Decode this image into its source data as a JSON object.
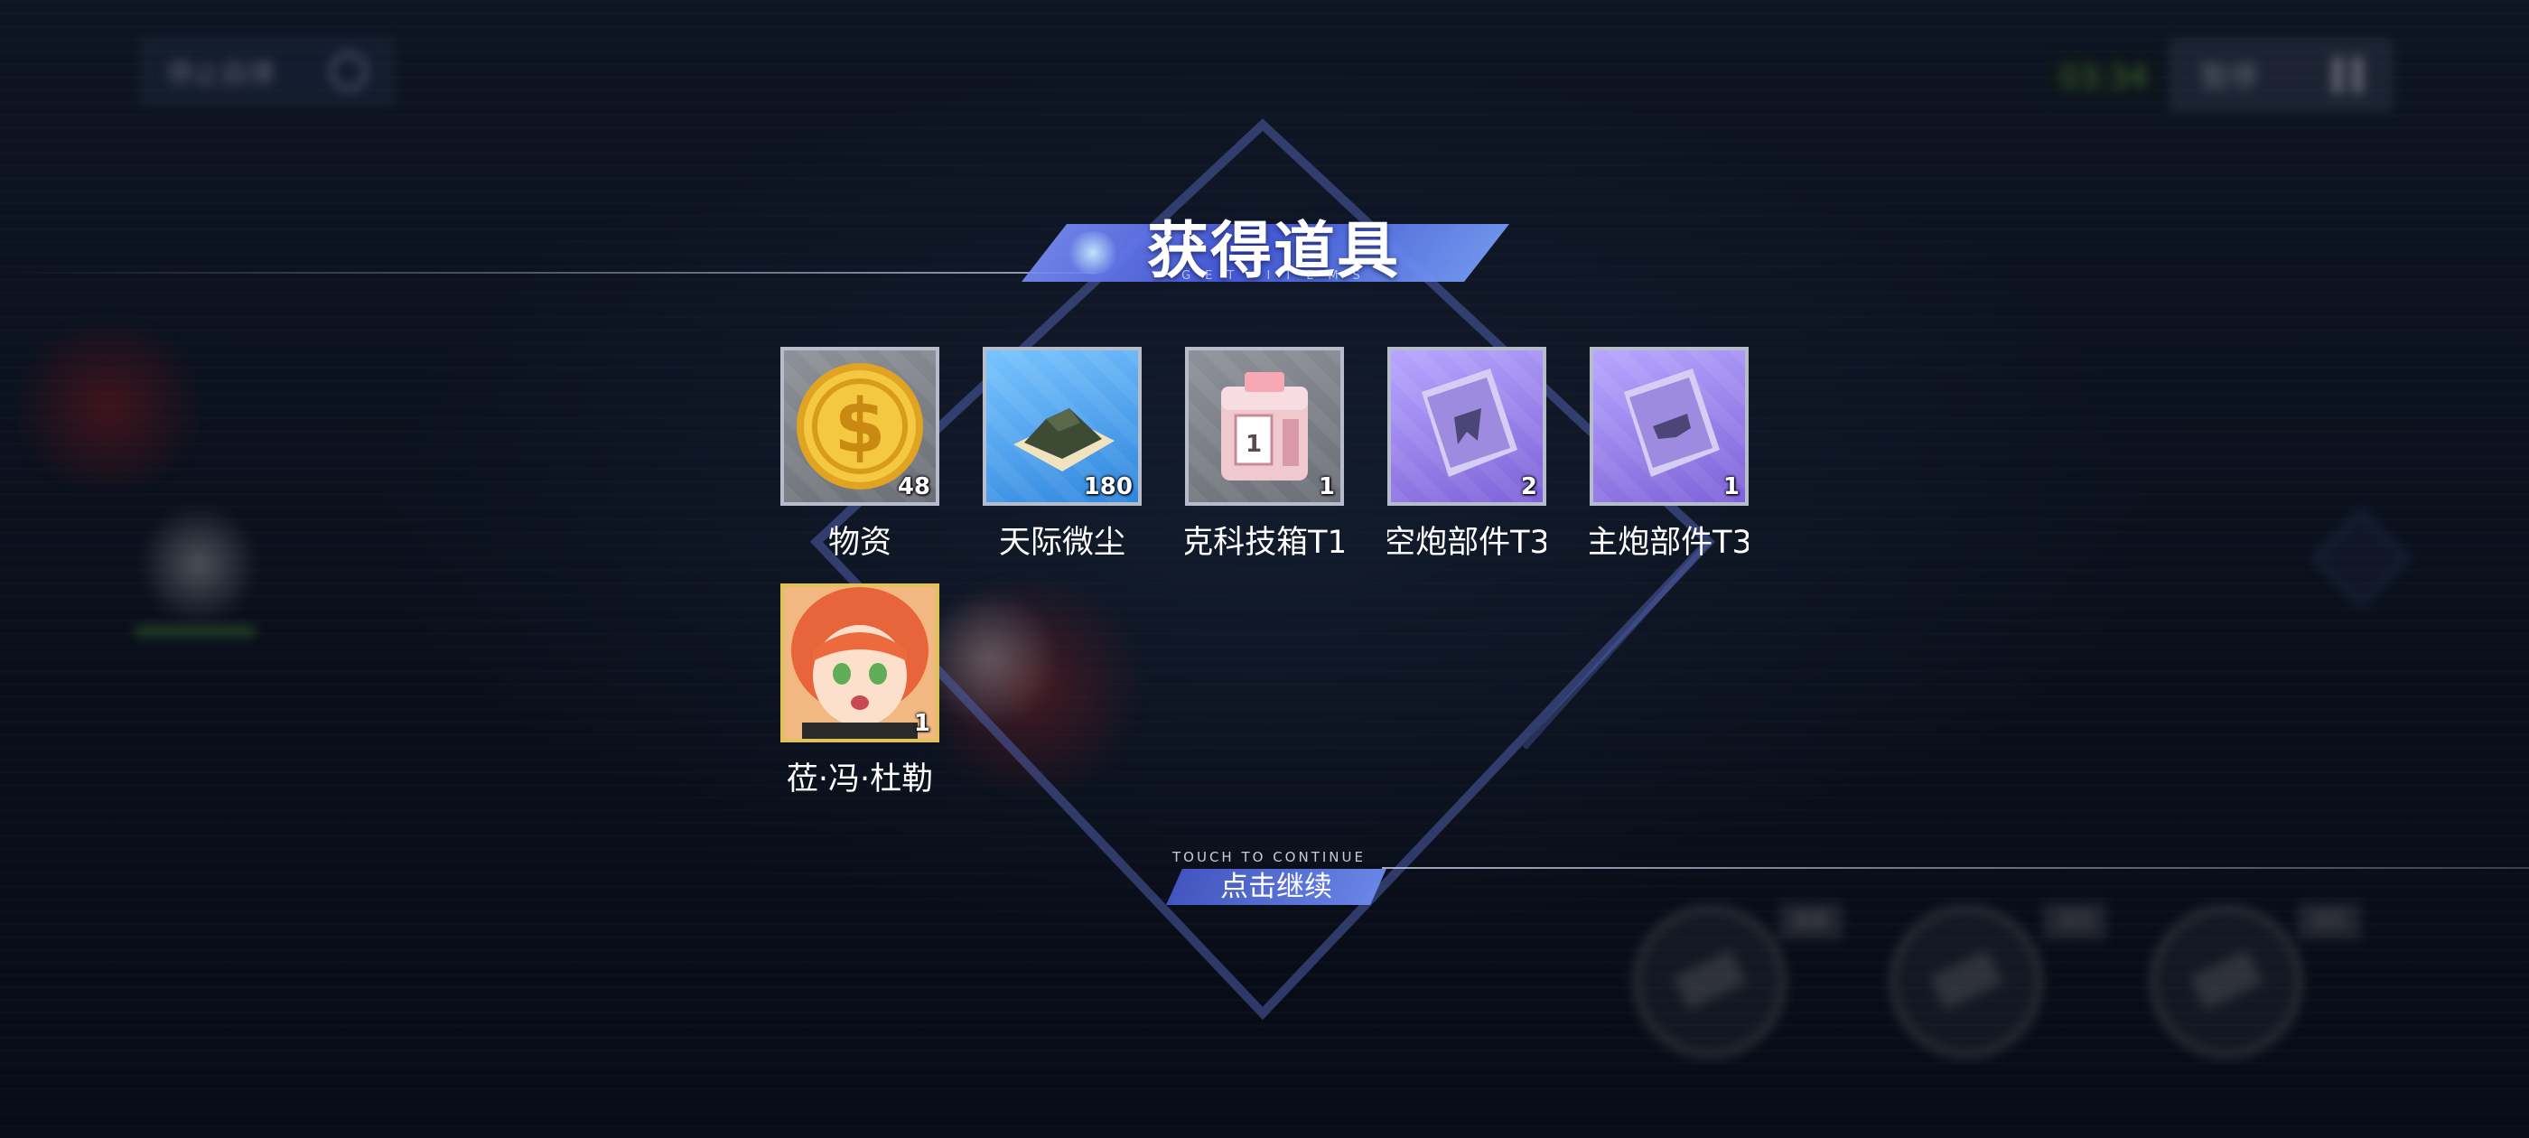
{
  "hud": {
    "auto_battle_label": "停止自律",
    "timer": "03:34",
    "pause_label": "暂停"
  },
  "skills": {
    "counts": [
      "8/8",
      "3/3",
      "0/1"
    ]
  },
  "reward_panel": {
    "title": "获得道具",
    "subtitle": "GET ITEMS",
    "continue_hint": "TOUCH TO CONTINUE",
    "continue_label": "点击继续"
  },
  "items": [
    {
      "name": "物资",
      "count": "48",
      "icon": "coin-icon",
      "rarity": "gray"
    },
    {
      "name": "天际微尘",
      "count": "180",
      "icon": "dust-pile-icon",
      "rarity": "blue"
    },
    {
      "name": "克科技箱T1",
      "count": "1",
      "icon": "tech-box-icon",
      "rarity": "gray"
    },
    {
      "name": "空炮部件T3",
      "count": "2",
      "icon": "part-book-icon",
      "rarity": "purple"
    },
    {
      "name": "主炮部件T3",
      "count": "1",
      "icon": "part-book-icon",
      "rarity": "purple"
    },
    {
      "name": "莅·冯·杜勒",
      "count": "1",
      "icon": "character-portrait",
      "rarity": "gold"
    }
  ],
  "colors": {
    "accent_blue": "#5a74e0",
    "frame_gray": "#b6bcc9",
    "frame_gold": "#e0c15a"
  }
}
